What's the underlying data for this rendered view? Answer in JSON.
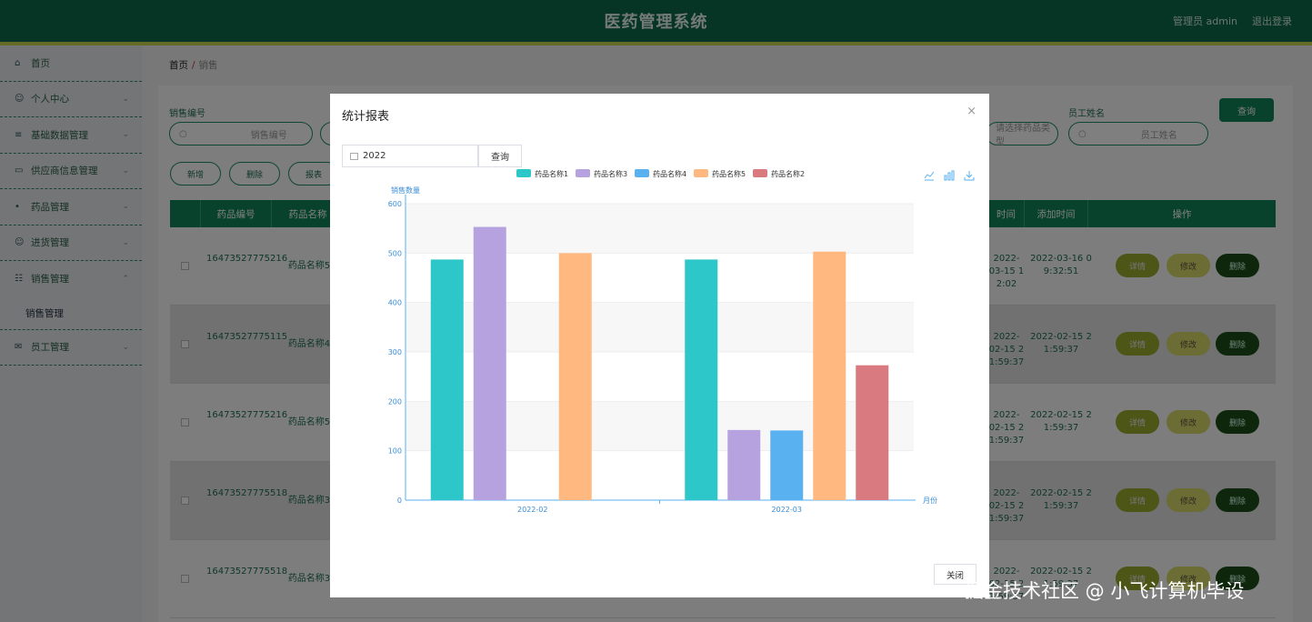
{
  "header": {
    "title": "医药管理系统",
    "user": "管理员 admin",
    "logout": "退出登录"
  },
  "sidebar": {
    "items": [
      {
        "label": "首页",
        "icon": "home-icon"
      },
      {
        "label": "个人中心",
        "icon": "person-icon"
      },
      {
        "label": "基础数据管理",
        "icon": "list-icon"
      },
      {
        "label": "供应商信息管理",
        "icon": "card-icon"
      },
      {
        "label": "药品管理",
        "icon": "mic-icon"
      },
      {
        "label": "进货管理",
        "icon": "person-icon"
      },
      {
        "label": "销售管理",
        "icon": "grid-icon",
        "expanded": true
      },
      {
        "label": "员工管理",
        "icon": "mail-icon"
      }
    ],
    "sub_item": "销售管理"
  },
  "breadcrumb": {
    "home": "首页",
    "separator": "/",
    "current": "销售"
  },
  "search": {
    "label_number": "销售编号",
    "placeholder_number": "销售编号",
    "label_employee": "员工姓名",
    "placeholder_employee": "员工姓名",
    "placeholder_type": "请选择药品类型",
    "button": "查询"
  },
  "toolbar": {
    "add": "新增",
    "delete": "删除",
    "report": "报表"
  },
  "table": {
    "headers": [
      "药品编号",
      "药品名称",
      "添加时间",
      "操作"
    ],
    "header_partial_time": "时间",
    "rows": [
      {
        "id": "16473527775216",
        "name": "药品名称5",
        "time_a": "2022-03-15 1",
        "time_a2": "2:02",
        "time_b": "2022-03-16 0",
        "time_b2": "9:32:51"
      },
      {
        "id": "16473527775115",
        "name": "药品名称4",
        "time_a": "2022-02-15 2",
        "time_a2": "1:59:37",
        "time_b": "2022-02-15 2",
        "time_b2": "1:59:37"
      },
      {
        "id": "16473527775216",
        "name": "药品名称5",
        "time_a": "2022-02-15 2",
        "time_a2": "1:59:37",
        "time_b": "2022-02-15 2",
        "time_b2": "1:59:37"
      },
      {
        "id": "16473527775518",
        "name": "药品名称3",
        "time_a": "2022-02-15 2",
        "time_a2": "1:59:37",
        "time_b": "2022-02-15 2",
        "time_b2": "1:59:37"
      },
      {
        "id": "16473527775518",
        "name": "药品名称3",
        "time_a": "2022-02-15 2",
        "time_a2": "1:59:37",
        "time_b": "2022-02-15 2",
        "time_b2": "1:59:37"
      }
    ],
    "actions": {
      "detail": "详情",
      "edit": "修改",
      "delete": "删除"
    }
  },
  "modal": {
    "title": "统计报表",
    "close_x": "×",
    "year_value": "2022",
    "query": "查询",
    "close_button": "关闭"
  },
  "chart_data": {
    "type": "bar",
    "ylabel": "销售数量",
    "xlabel": "月份",
    "ylim": [
      0,
      600
    ],
    "yticks": [
      0,
      100,
      200,
      300,
      400,
      500,
      600
    ],
    "categories": [
      "2022-02",
      "2022-03"
    ],
    "series": [
      {
        "name": "药品名称1",
        "color": "#2ec7c9",
        "values": [
          487,
          487
        ]
      },
      {
        "name": "药品名称3",
        "color": "#b6a2de",
        "values": [
          553,
          142
        ]
      },
      {
        "name": "药品名称4",
        "color": "#5ab1ef",
        "values": [
          0,
          141
        ]
      },
      {
        "name": "药品名称5",
        "color": "#ffb980",
        "values": [
          500,
          503
        ]
      },
      {
        "name": "药品名称2",
        "color": "#d87a80",
        "values": [
          0,
          273
        ]
      }
    ],
    "grid": true,
    "legend": "top"
  },
  "watermark": "掘金技术社区 @ 小飞计算机毕设"
}
